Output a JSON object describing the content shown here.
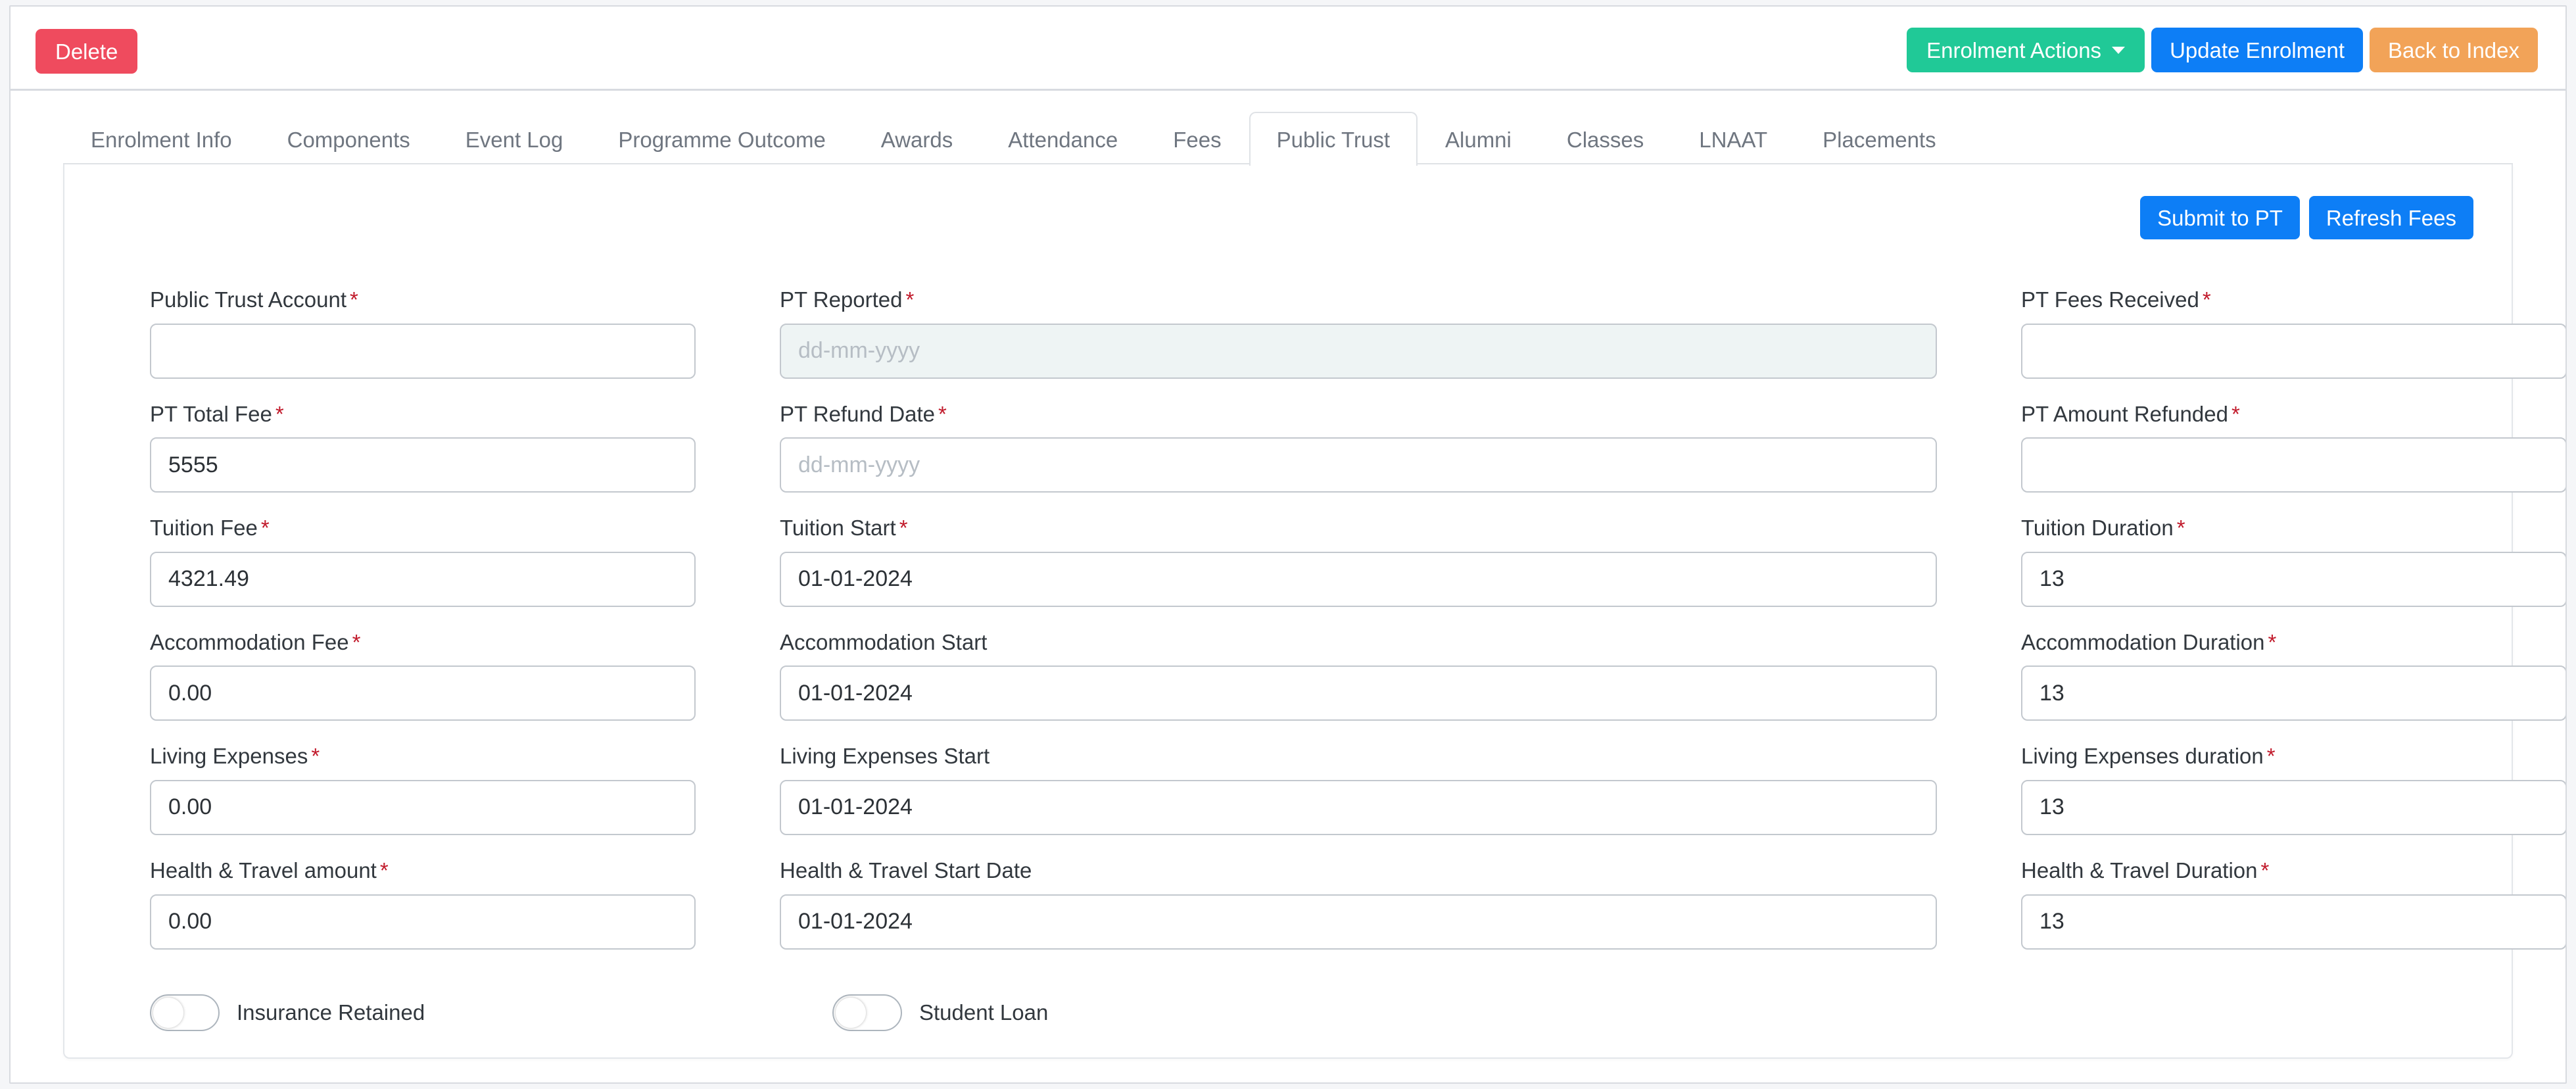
{
  "topbar": {
    "delete_label": "Delete",
    "enrolment_actions_label": "Enrolment Actions",
    "update_enrolment_label": "Update Enrolment",
    "back_to_index_label": "Back to Index",
    "colors": {
      "delete": "#ef4b5e",
      "enrolment_actions": "#20c997",
      "update_enrolment": "#0d7ef6",
      "back_to_index": "#f2a358"
    }
  },
  "tabs": [
    {
      "label": "Enrolment Info",
      "active": false
    },
    {
      "label": "Components",
      "active": false
    },
    {
      "label": "Event Log",
      "active": false
    },
    {
      "label": "Programme Outcome",
      "active": false
    },
    {
      "label": "Awards",
      "active": false
    },
    {
      "label": "Attendance",
      "active": false
    },
    {
      "label": "Fees",
      "active": false
    },
    {
      "label": "Public Trust",
      "active": true
    },
    {
      "label": "Alumni",
      "active": false
    },
    {
      "label": "Classes",
      "active": false
    },
    {
      "label": "LNAAT",
      "active": false
    },
    {
      "label": "Placements",
      "active": false
    }
  ],
  "card_actions": {
    "submit_label": "Submit to PT",
    "refresh_label": "Refresh Fees",
    "color": "#0d7ef6"
  },
  "fields": {
    "public_trust_account": {
      "label": "Public Trust Account",
      "required": true,
      "value": "",
      "placeholder": ""
    },
    "pt_reported": {
      "label": "PT Reported",
      "required": true,
      "value": "",
      "placeholder": "dd-mm-yyyy"
    },
    "pt_fees_received": {
      "label": "PT Fees Received",
      "required": true,
      "value": "",
      "placeholder": ""
    },
    "pt_total_fee": {
      "label": "PT Total Fee",
      "required": true,
      "value": "5555",
      "placeholder": ""
    },
    "pt_refund_date": {
      "label": "PT Refund Date",
      "required": true,
      "value": "",
      "placeholder": "dd-mm-yyyy"
    },
    "pt_amount_refunded": {
      "label": "PT Amount Refunded",
      "required": true,
      "value": "",
      "placeholder": ""
    },
    "tuition_fee": {
      "label": "Tuition Fee",
      "required": true,
      "value": "4321.49",
      "placeholder": ""
    },
    "tuition_start": {
      "label": "Tuition Start",
      "required": true,
      "value": "01-01-2024",
      "placeholder": ""
    },
    "tuition_duration": {
      "label": "Tuition Duration",
      "required": true,
      "value": "13",
      "placeholder": ""
    },
    "accommodation_fee": {
      "label": "Accommodation Fee",
      "required": true,
      "value": "0.00",
      "placeholder": ""
    },
    "accommodation_start": {
      "label": "Accommodation Start",
      "required": false,
      "value": "01-01-2024",
      "placeholder": ""
    },
    "accommodation_duration": {
      "label": "Accommodation Duration",
      "required": true,
      "value": "13",
      "placeholder": ""
    },
    "living_expenses": {
      "label": "Living Expenses",
      "required": true,
      "value": "0.00",
      "placeholder": ""
    },
    "living_expenses_start": {
      "label": "Living Expenses Start",
      "required": false,
      "value": "01-01-2024",
      "placeholder": ""
    },
    "living_expenses_duration": {
      "label": "Living Expenses duration",
      "required": true,
      "value": "13",
      "placeholder": ""
    },
    "health_travel_amount": {
      "label": "Health & Travel amount",
      "required": true,
      "value": "0.00",
      "placeholder": ""
    },
    "health_travel_start": {
      "label": "Health & Travel Start Date",
      "required": false,
      "value": "01-01-2024",
      "placeholder": ""
    },
    "health_travel_duration": {
      "label": "Health & Travel Duration",
      "required": true,
      "value": "13",
      "placeholder": ""
    }
  },
  "toggles": {
    "insurance_retained": {
      "label": "Insurance Retained",
      "checked": false
    },
    "student_loan": {
      "label": "Student Loan",
      "checked": false
    }
  }
}
